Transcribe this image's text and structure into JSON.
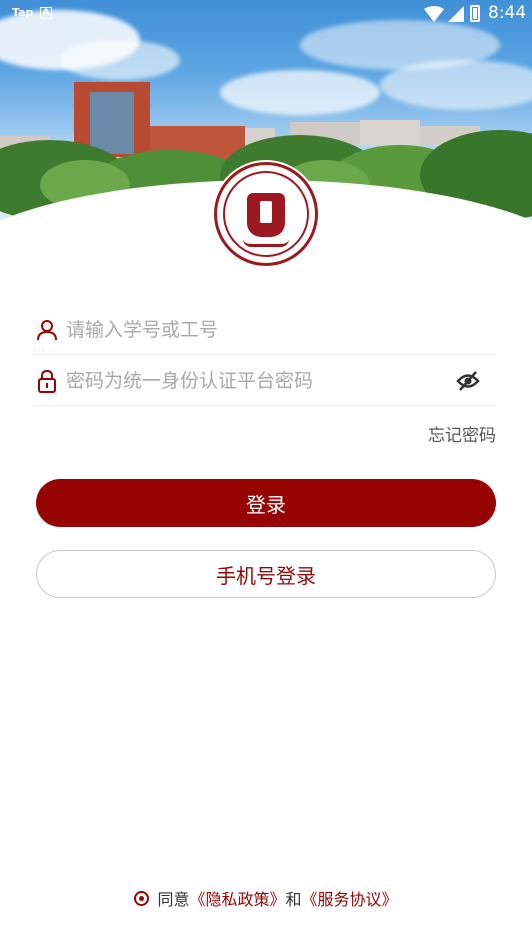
{
  "status_bar": {
    "tap_label": "Tap",
    "a_label": "A",
    "time": "8:44"
  },
  "form": {
    "username_placeholder": "请输入学号或工号",
    "password_placeholder": "密码为统一身份认证平台密码",
    "forgot_label": "忘记密码"
  },
  "buttons": {
    "login": "登录",
    "phone_login": "手机号登录"
  },
  "agreement": {
    "prefix": "同意",
    "privacy": "《隐私政策》",
    "and": "和",
    "service": "《服务协议》"
  },
  "colors": {
    "primary": "#970404",
    "placeholder": "#a9a9a9"
  },
  "icons": [
    "user-icon",
    "lock-icon",
    "eye-off-icon",
    "wifi-icon",
    "signal-icon",
    "battery-icon"
  ]
}
